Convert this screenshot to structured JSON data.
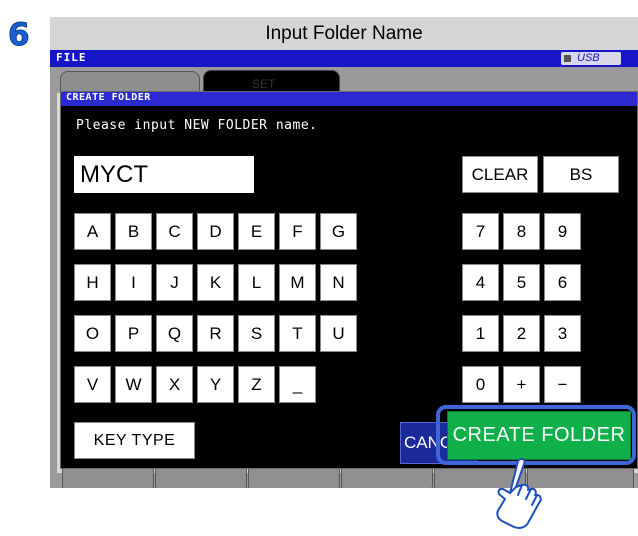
{
  "step": {
    "number": "6"
  },
  "title": "Input Folder Name",
  "status_bar": {
    "label": "FILE",
    "usb_label": "USB"
  },
  "tabs": [
    {
      "label": ""
    },
    {
      "label": "SET"
    }
  ],
  "dialog": {
    "header": "CREATE FOLDER",
    "prompt": "Please input NEW FOLDER name.",
    "folder_name_value": "MYCT"
  },
  "keys": {
    "letters_row1": [
      "A",
      "B",
      "C",
      "D",
      "E",
      "F",
      "G"
    ],
    "letters_row2": [
      "H",
      "I",
      "J",
      "K",
      "L",
      "M",
      "N"
    ],
    "letters_row3": [
      "O",
      "P",
      "Q",
      "R",
      "S",
      "T",
      "U"
    ],
    "letters_row4": [
      "V",
      "W",
      "X",
      "Y",
      "Z",
      "_"
    ],
    "clear": "CLEAR",
    "bs": "BS",
    "numbers_row1": [
      "7",
      "8",
      "9"
    ],
    "numbers_row2": [
      "4",
      "5",
      "6"
    ],
    "numbers_row3": [
      "1",
      "2",
      "3"
    ],
    "numbers_row4": [
      "0",
      "+",
      "−"
    ]
  },
  "buttons": {
    "key_type": "KEY TYPE",
    "cancel": "CANCEL",
    "create_folder": "CREATE FOLDER"
  },
  "colors": {
    "accent_blue": "#1616c8",
    "create_green": "#0fb04a",
    "cancel_blue": "#1a2a9a",
    "step_blue": "#1a5fd0"
  }
}
